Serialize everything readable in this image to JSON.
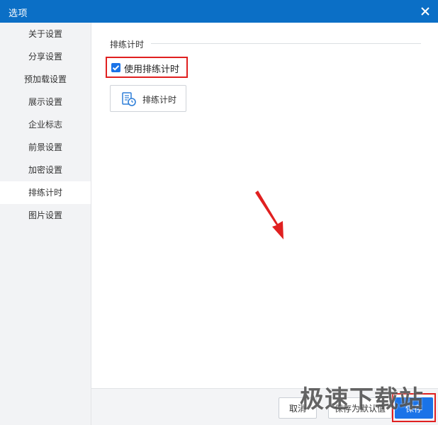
{
  "window": {
    "title": "选项",
    "close_icon": "close-icon"
  },
  "sidebar": {
    "items": [
      {
        "label": "关于设置"
      },
      {
        "label": "分享设置"
      },
      {
        "label": "预加载设置"
      },
      {
        "label": "展示设置"
      },
      {
        "label": "企业标志"
      },
      {
        "label": "前景设置"
      },
      {
        "label": "加密设置"
      },
      {
        "label": "排练计时",
        "active": true
      },
      {
        "label": "图片设置"
      }
    ]
  },
  "main": {
    "section_title": "排练计时",
    "checkbox": {
      "label": "使用排练计时",
      "checked": true
    },
    "timer_button": {
      "label": "排练计时",
      "icon": "timer-document-icon"
    }
  },
  "footer": {
    "cancel_label": "取消",
    "save_default_label": "保存为默认值",
    "save_label": "保存"
  },
  "watermark": {
    "text": "极速下载站"
  },
  "colors": {
    "title_bar": "#0b6fc6",
    "accent": "#1a73e8",
    "highlight": "#e02020",
    "sidebar_bg": "#f2f3f5"
  }
}
